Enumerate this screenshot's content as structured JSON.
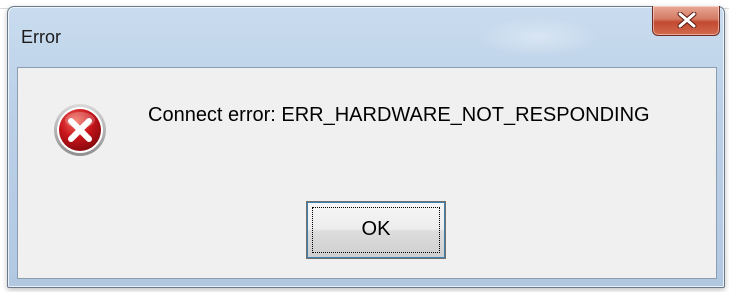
{
  "window": {
    "title": "Error",
    "close_icon": "close-icon"
  },
  "dialog": {
    "icon": "error-icon",
    "message": "Connect error: ERR_HARDWARE_NOT_RESPONDING",
    "ok_label": "OK"
  },
  "colors": {
    "titlebar": "#bcd1e8",
    "client_bg": "#f0f0f0",
    "close_button": "#c24a30",
    "error_icon_red": "#c8141b"
  }
}
